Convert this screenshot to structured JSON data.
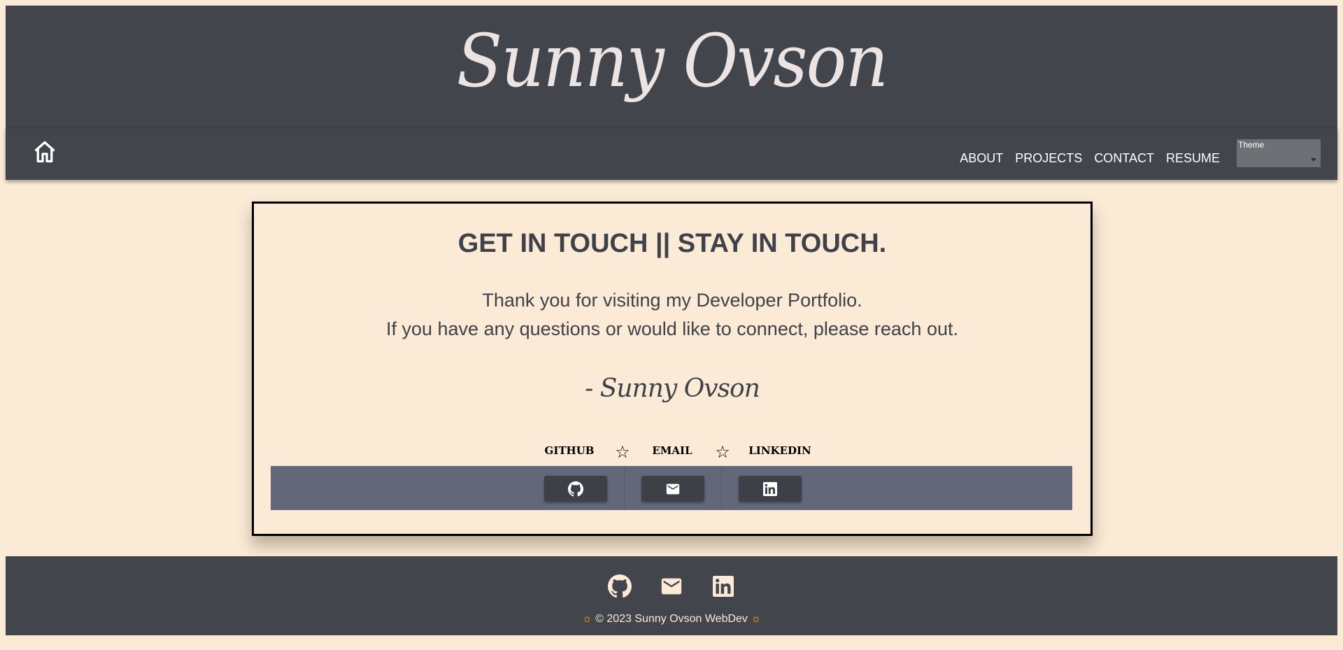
{
  "header": {
    "brand": "Sunny Ovson"
  },
  "nav": {
    "home_icon": "home-icon",
    "links": [
      "ABOUT",
      "PROJECTS",
      "CONTACT",
      "RESUME"
    ],
    "theme_label": "Theme"
  },
  "card": {
    "title": "GET IN TOUCH || STAY IN TOUCH.",
    "line1": "Thank you for visiting my Developer Portfolio.",
    "line2": "If you have any questions or would like to connect, please reach out.",
    "signature": "- Sunny Ovson",
    "social_labels": [
      "GITHUB",
      "EMAIL",
      "LINKEDIN"
    ],
    "separator": "☆",
    "social_icons": [
      "github-icon",
      "mail-icon",
      "linkedin-icon"
    ]
  },
  "footer": {
    "icons": [
      "github-icon",
      "mail-icon",
      "linkedin-icon"
    ],
    "sun_left": "☼",
    "copyright": "© 2023 Sunny Ovson WebDev",
    "sun_right": "☼"
  },
  "colors": {
    "background": "#faead6",
    "dark": "#42454c",
    "social_bar": "#626779",
    "button": "#3d4046",
    "accent_sun": "#f5b800"
  }
}
